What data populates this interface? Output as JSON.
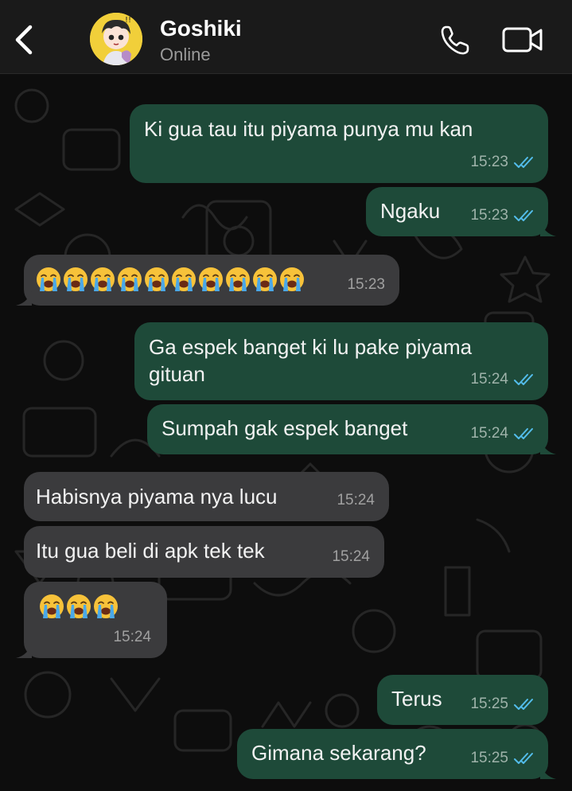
{
  "header": {
    "contact_name": "Goshiki",
    "status": "Online",
    "back_icon": "chevron-left-icon",
    "call_icon": "phone-icon",
    "video_icon": "video-camera-icon"
  },
  "colors": {
    "outgoing_bubble": "#1e4a39",
    "incoming_bubble": "#3b3b3d",
    "tick_blue": "#53bdeb",
    "avatar_bg": "#f1cf3a"
  },
  "messages": [
    {
      "dir": "out",
      "text": "Ki gua tau itu piyama punya mu kan",
      "time": "15:23",
      "read": true
    },
    {
      "dir": "out",
      "text": "Ngaku",
      "time": "15:23",
      "read": true
    },
    {
      "dir": "in",
      "text": "😭😭😭😭😭😭😭😭😭😭",
      "time": "15:23",
      "emoji_count": 10
    },
    {
      "dir": "out",
      "text": "Ga espek banget ki lu pake piyama gituan",
      "time": "15:24",
      "read": true
    },
    {
      "dir": "out",
      "text": "Sumpah gak espek banget",
      "time": "15:24",
      "read": true
    },
    {
      "dir": "in",
      "text": "Habisnya piyama nya lucu",
      "time": "15:24"
    },
    {
      "dir": "in",
      "text": "Itu gua beli di apk tek tek",
      "time": "15:24"
    },
    {
      "dir": "in",
      "text": "😭😭😭",
      "time": "15:24",
      "emoji_count": 3
    },
    {
      "dir": "out",
      "text": "Terus",
      "time": "15:25",
      "read": true
    },
    {
      "dir": "out",
      "text": "Gimana sekarang?",
      "time": "15:25",
      "read": true
    }
  ]
}
